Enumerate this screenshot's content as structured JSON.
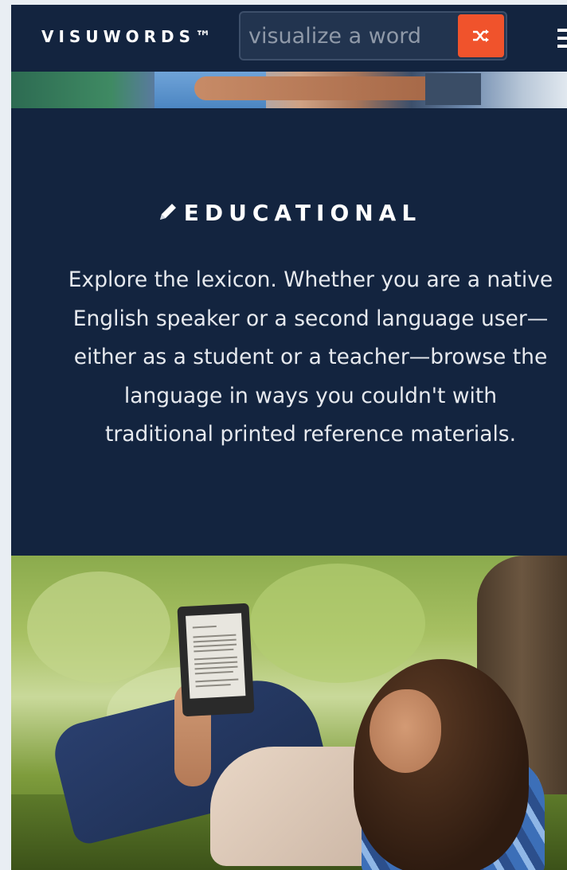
{
  "header": {
    "logo": "VISUWORDS™",
    "search_placeholder": "visualize a word",
    "shuffle_icon": "shuffle-icon",
    "menu_icon": "hamburger-menu-icon"
  },
  "educational": {
    "icon": "pencil-icon",
    "title": "EDUCATIONAL",
    "text": "Explore the lexicon. Whether you are a native English speaker or a second language user—either as a student or a teacher—browse the language in ways you couldn't with traditional printed reference materials."
  },
  "colors": {
    "navy": "#13243f",
    "accent": "#f0532c"
  }
}
